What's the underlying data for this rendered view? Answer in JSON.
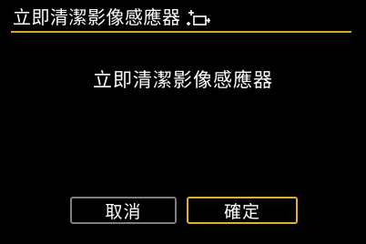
{
  "header": {
    "title": "立即清潔影像感應器",
    "icon": "sensor-clean-icon"
  },
  "dialog": {
    "message": "立即清潔影像感應器"
  },
  "buttons": {
    "cancel_label": "取消",
    "ok_label": "確定"
  },
  "colors": {
    "background": "#000000",
    "text": "#ffffff",
    "accent": "#e2b12c",
    "rule": "#d7a52a",
    "inactive_border": "#7e7e7e"
  }
}
